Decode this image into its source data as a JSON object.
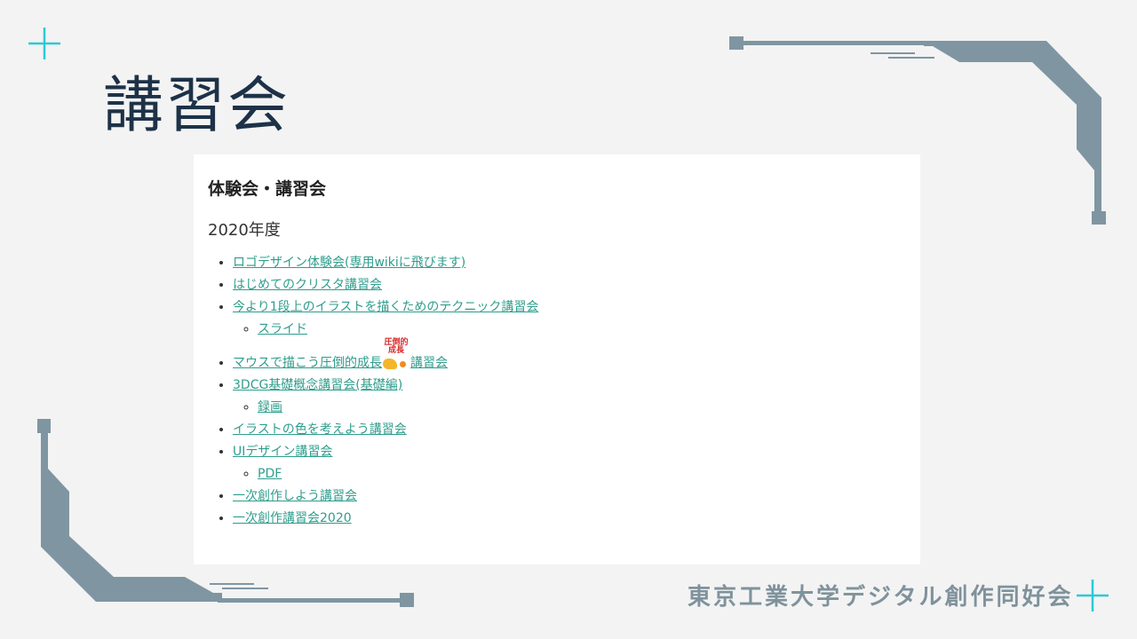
{
  "slide": {
    "title": "講習会",
    "footer": "東京工業大学デジタル創作同好会"
  },
  "card": {
    "heading": "体験会・講習会",
    "year": "2020年度",
    "items": [
      {
        "label": "ロゴデザイン体験会(専用wikiに飛びます)"
      },
      {
        "label": "はじめてのクリスタ講習会"
      },
      {
        "label": "今より1段上のイラストを描くためのテクニック講習会",
        "sub": [
          "スライド"
        ]
      },
      {
        "label_before": "マウスで描こう圧倒的成長",
        "badge_text": "圧倒的成長",
        "label_after": "講習会"
      },
      {
        "label": "3DCG基礎概念講習会(基礎編)",
        "sub": [
          "録画"
        ]
      },
      {
        "label": "イラストの色を考えよう講習会"
      },
      {
        "label": "UIデザイン講習会",
        "sub": [
          "PDF"
        ]
      },
      {
        "label": "一次創作しよう講習会"
      },
      {
        "label": "一次創作講習会2020"
      }
    ]
  },
  "colors": {
    "background": "#f3f3f3",
    "title": "#1d3248",
    "link": "#2f9d8c",
    "frame": "#7f96a2",
    "accent": "#2cc9d4"
  },
  "icons": {
    "top_left": "plus-icon",
    "bottom_right": "plus-icon"
  }
}
